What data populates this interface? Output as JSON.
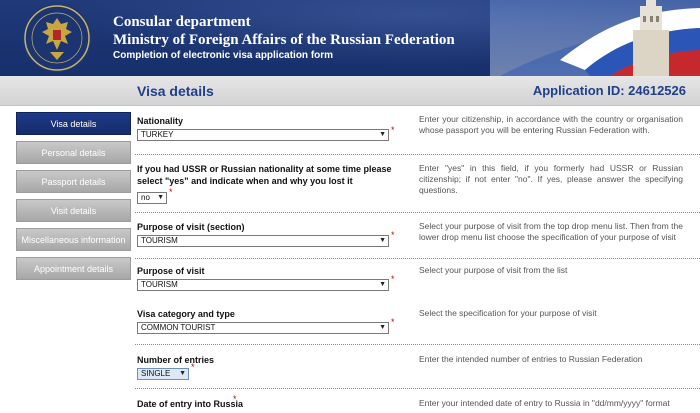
{
  "header": {
    "line1": "Consular department",
    "line2": "Ministry of Foreign Affairs of the Russian Federation",
    "line3": "Completion of electronic visa application form"
  },
  "titlebar": {
    "page_title": "Visa details",
    "application_id": "Application ID: 24612526"
  },
  "sidebar": {
    "items": [
      {
        "label": "Visa details",
        "active": true
      },
      {
        "label": "Personal details",
        "active": false
      },
      {
        "label": "Passport details",
        "active": false
      },
      {
        "label": "Visit details",
        "active": false
      },
      {
        "label": "Miscellaneous information",
        "active": false
      },
      {
        "label": "Appointment details",
        "active": false
      }
    ]
  },
  "form": {
    "nationality": {
      "label": "Nationality",
      "value": "TURKEY",
      "help": "Enter your citizenship, in accordance with the country or organisation whose passport you will be entering Russian Federation with."
    },
    "ussr": {
      "label": "If you had USSR or Russian nationality at some time please select \"yes\" and indicate when and why you lost it",
      "value": "no",
      "help": "Enter \"yes\" in this field, if you formerly had USSR or Russian citizenship; if not enter \"no\". If yes, please answer the specifying questions."
    },
    "purpose_section": {
      "label": "Purpose of visit (section)",
      "value": "TOURISM",
      "help": "Select your purpose of visit from the top drop menu list. Then from the lower drop menu list choose the specification of your purpose of visit"
    },
    "purpose": {
      "label": "Purpose of visit",
      "value": "TOURISM",
      "help": "Select your purpose of visit from the list"
    },
    "category": {
      "label": "Visa category and type",
      "value": "COMMON TOURIST",
      "help": "Select the specification for your purpose of visit"
    },
    "entries": {
      "label": "Number of entries",
      "value": "SINGLE",
      "help": "Enter the intended number of entries to Russian Federation"
    },
    "entry_date": {
      "label": "Date of entry into Russia",
      "help": "Enter your intended date of entry to Russia in \"dd/mm/yyyy\" format"
    }
  },
  "colors": {
    "header_bg": "#1a3370",
    "active_nav": "#1e3a8a",
    "title_text": "#1f3f8a",
    "required": "#d00000"
  }
}
